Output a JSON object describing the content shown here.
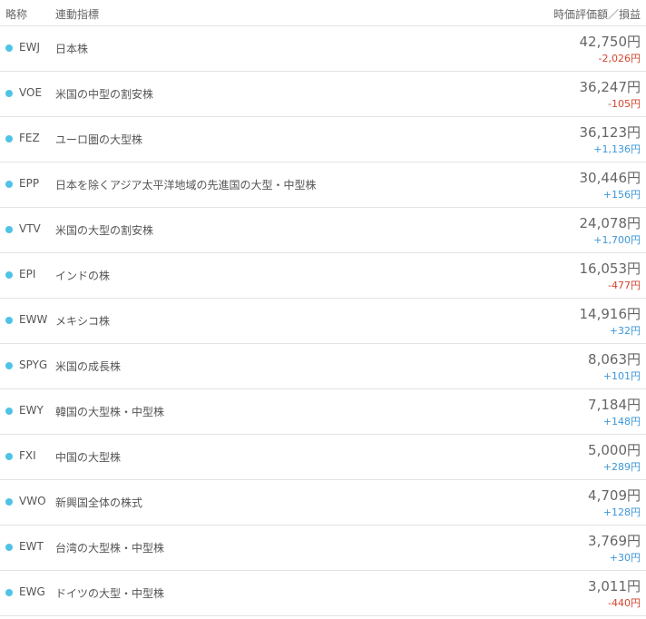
{
  "header": {
    "abbr": "略称",
    "index": "連動指標",
    "value_pl": "時価評価額／損益"
  },
  "colors": {
    "dot": "#4fc3e6",
    "loss": "#d2462f",
    "gain": "#3d96d8"
  },
  "rows": [
    {
      "ticker": "EWJ",
      "name": "日本株",
      "value": "42,750円",
      "pl": "-2,026円",
      "sign": "neg"
    },
    {
      "ticker": "VOE",
      "name": "米国の中型の割安株",
      "value": "36,247円",
      "pl": "-105円",
      "sign": "neg"
    },
    {
      "ticker": "FEZ",
      "name": "ユーロ圏の大型株",
      "value": "36,123円",
      "pl": "+1,136円",
      "sign": "pos"
    },
    {
      "ticker": "EPP",
      "name": "日本を除くアジア太平洋地域の先進国の大型・中型株",
      "value": "30,446円",
      "pl": "+156円",
      "sign": "pos"
    },
    {
      "ticker": "VTV",
      "name": "米国の大型の割安株",
      "value": "24,078円",
      "pl": "+1,700円",
      "sign": "pos"
    },
    {
      "ticker": "EPI",
      "name": "インドの株",
      "value": "16,053円",
      "pl": "-477円",
      "sign": "neg"
    },
    {
      "ticker": "EWW",
      "name": "メキシコ株",
      "value": "14,916円",
      "pl": "+32円",
      "sign": "pos"
    },
    {
      "ticker": "SPYG",
      "name": "米国の成長株",
      "value": "8,063円",
      "pl": "+101円",
      "sign": "pos"
    },
    {
      "ticker": "EWY",
      "name": "韓国の大型株・中型株",
      "value": "7,184円",
      "pl": "+148円",
      "sign": "pos"
    },
    {
      "ticker": "FXI",
      "name": "中国の大型株",
      "value": "5,000円",
      "pl": "+289円",
      "sign": "pos"
    },
    {
      "ticker": "VWO",
      "name": "新興国全体の株式",
      "value": "4,709円",
      "pl": "+128円",
      "sign": "pos"
    },
    {
      "ticker": "EWT",
      "name": "台湾の大型株・中型株",
      "value": "3,769円",
      "pl": "+30円",
      "sign": "pos"
    },
    {
      "ticker": "EWG",
      "name": "ドイツの大型・中型株",
      "value": "3,011円",
      "pl": "-440円",
      "sign": "neg"
    }
  ]
}
